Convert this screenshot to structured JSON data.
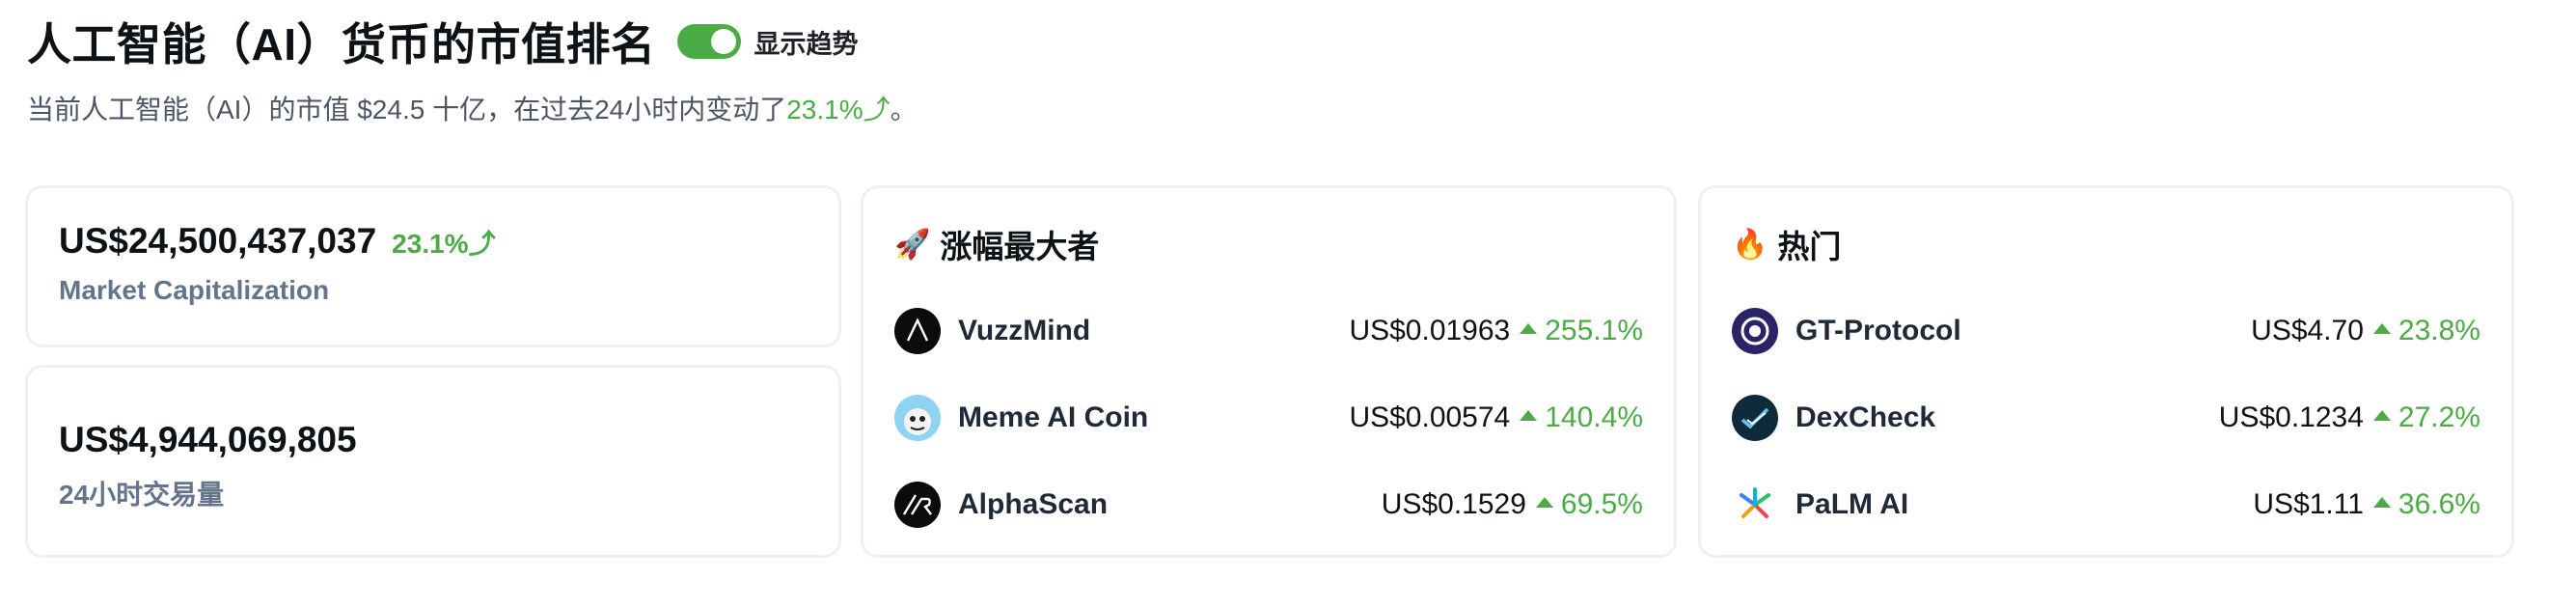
{
  "header": {
    "title": "人工智能（AI）货币的市值排名",
    "toggle_label": "显示趋势",
    "subtitle_prefix": "当前人工智能（AI）的市值 $24.5 十亿，在过去24小时内变动了",
    "subtitle_change": "23.1%⤴",
    "subtitle_suffix": "。"
  },
  "market_cap": {
    "value": "US$24,500,437,037",
    "change": "23.1%⤴",
    "label": "Market Capitalization"
  },
  "volume": {
    "value": "US$4,944,069,805",
    "label": "24小时交易量"
  },
  "gainers": {
    "emoji": "🚀",
    "title": "涨幅最大者",
    "items": [
      {
        "name": "VuzzMind",
        "price": "US$0.01963",
        "change": "255.1%"
      },
      {
        "name": "Meme AI Coin",
        "price": "US$0.00574",
        "change": "140.4%"
      },
      {
        "name": "AlphaScan",
        "price": "US$0.1529",
        "change": "69.5%"
      }
    ]
  },
  "trending": {
    "emoji": "🔥",
    "title": "热门",
    "items": [
      {
        "name": "GT-Protocol",
        "price": "US$4.70",
        "change": "23.8%"
      },
      {
        "name": "DexCheck",
        "price": "US$0.1234",
        "change": "27.2%"
      },
      {
        "name": "PaLM AI",
        "price": "US$1.11",
        "change": "36.6%"
      }
    ]
  },
  "colors": {
    "up": "#4bab44",
    "toggle_on": "#4bab44"
  }
}
